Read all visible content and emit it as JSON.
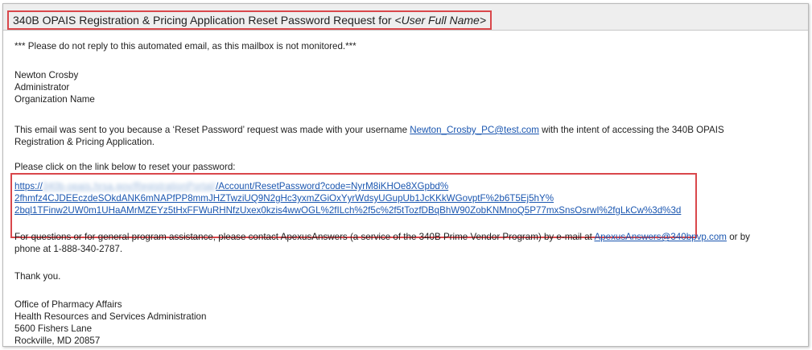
{
  "email": {
    "subject_prefix": "340B OPAIS Registration & Pricing Application Reset Password Request for ",
    "subject_placeholder": "<User Full Name>",
    "notice": "*** Please do not reply to this automated email, as this mailbox is not monitored.***",
    "recipient": {
      "name": "Newton Crosby",
      "role": "Administrator",
      "organization": "Organization Name"
    },
    "intro_before": "This email was sent to you because a ‘Reset Password’ request was made with your username ",
    "username_link": "Newton_Crosby_PC@test.com",
    "intro_after_line1": " with the intent of accessing the 340B OPAIS",
    "intro_line2": "Registration & Pricing Application.",
    "reset_prompt": "Please click on the link below to reset your password:",
    "reset_link": {
      "scheme": "https://",
      "obscured_host": "340b-opais.hrsa.gov/RegistrationPortal/",
      "line1_rest": "/Account/ResetPassword?code=NyrM8iKHOe8XGpbd%",
      "line2": "2fhmfz4CJDEEczdeSOkdANK6mNAPfPP8mmJHZTwziUQ9N2gHc3yxmZGiOxYyrWdsyUGupUb1JcKKkWGovptF%2b6T5Ej5hY%",
      "line3": "2bql1TFinw2UW0m1UHaAMrMZEYz5tHxFFWuRHNfzUxex0kzis4wwOGL%2fILch%2f5c%2f5tTozfDBqBhW90ZobKNMnoQ5P77mxSnsOsrwI%2fgLkCw%3d%3d"
    },
    "contact_line1_before": "For questions or for general program assistance, please contact ApexusAnswers (a service of the 340B Prime Vendor Program) by e-mail at ",
    "contact_email": "ApexusAnswers@340bpvp.com",
    "contact_line1_after": " or by",
    "contact_line2": "phone at 1-888-340-2787.",
    "thanks": "Thank you.",
    "signature": {
      "office": "Office of Pharmacy Affairs",
      "agency": "Health Resources and Services Administration",
      "street": "5600 Fishers Lane",
      "city": "Rockville, MD  20857"
    }
  },
  "colors": {
    "highlight_border": "#d9474b",
    "link": "#1a56b0",
    "subject_bar": "#eeeeee"
  }
}
